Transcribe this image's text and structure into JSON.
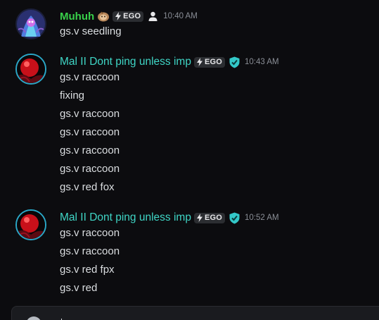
{
  "messages": [
    {
      "username": "Muhuh",
      "username_color": "#38d04a",
      "emoji": "sloth-emoji",
      "badge": "EGO",
      "role_icon": "person-icon",
      "timestamp": "10:40 AM",
      "lines": [
        "gs.v seedling"
      ]
    },
    {
      "username": "Mal II Dont ping unless imp",
      "username_color": "#3fd6c6",
      "badge": "EGO",
      "role_icon": "shield-check-icon",
      "timestamp": "10:43 AM",
      "lines": [
        "gs.v raccoon",
        "fixing",
        "gs.v raccoon",
        "gs.v raccoon",
        "gs.v raccoon",
        "gs.v raccoon",
        "gs.v red fox"
      ]
    },
    {
      "username": "Mal II Dont ping unless imp",
      "username_color": "#3fd6c6",
      "badge": "EGO",
      "role_icon": "shield-check-icon",
      "timestamp": "10:52 AM",
      "lines": [
        "gs.v raccoon",
        "gs.v raccoon",
        "gs.v red fpx",
        "gs.v red"
      ]
    }
  ],
  "colors": {
    "background": "#0c0c0f",
    "text": "#dbdee1",
    "timestamp": "#8a8e96",
    "badge_bg": "#2b2d31"
  }
}
